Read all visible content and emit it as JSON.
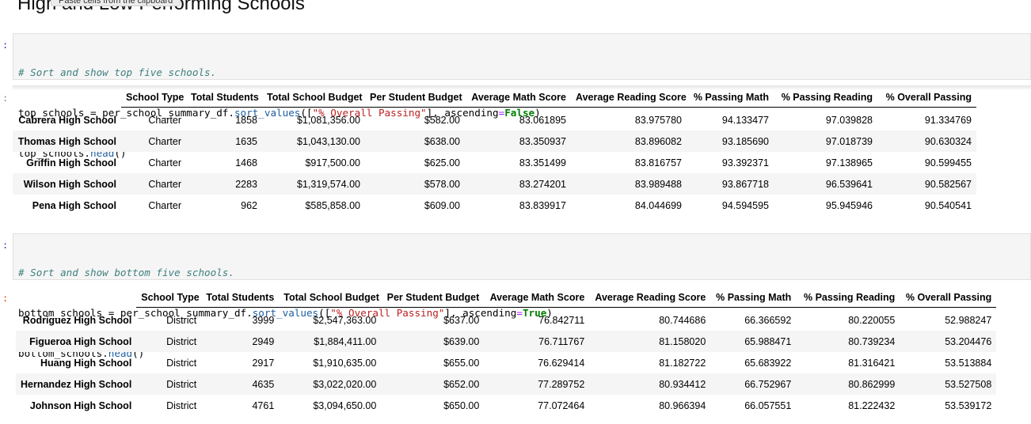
{
  "heading": "High and Low Performing Schools",
  "tooltip": "Paste cells from the clipboard",
  "prompt_colon": ":",
  "top_cell": {
    "comment": "# Sort and show top five schools.",
    "line2_var": "top_schools",
    "line2_eq": " = ",
    "line2_obj": "per_school_summary_df.",
    "line2_fn": "sort_values",
    "line2_open": "([",
    "line2_str": "\"% Overall Passing\"",
    "line2_mid": "], ascending",
    "line2_eqop": "=",
    "line2_kw": "False",
    "line2_close": ")",
    "line3_obj": "top_schools.",
    "line3_fn": "head",
    "line3_close": "()"
  },
  "bottom_cell": {
    "comment": "# Sort and show bottom five schools.",
    "line2_var": "bottom_schools",
    "line2_eq": " = ",
    "line2_obj": "per_school_summary_df.",
    "line2_fn": "sort_values",
    "line2_open": "([",
    "line2_str": "\"% Overall Passing\"",
    "line2_mid": "], ascending",
    "line2_eqop": "=",
    "line2_kw": "True",
    "line2_close": ")",
    "line3_obj": "bottom_schools.",
    "line3_fn": "head",
    "line3_close": "()"
  },
  "columns": [
    "School Type",
    "Total Students",
    "Total School Budget",
    "Per Student Budget",
    "Average Math Score",
    "Average Reading Score",
    "% Passing Math",
    "% Passing Reading",
    "% Overall Passing"
  ],
  "top_rows": [
    {
      "name": "Cabrera High School",
      "cells": [
        "Charter",
        "1858",
        "$1,081,356.00",
        "$582.00",
        "83.061895",
        "83.975780",
        "94.133477",
        "97.039828",
        "91.334769"
      ]
    },
    {
      "name": "Thomas High School",
      "cells": [
        "Charter",
        "1635",
        "$1,043,130.00",
        "$638.00",
        "83.350937",
        "83.896082",
        "93.185690",
        "97.018739",
        "90.630324"
      ]
    },
    {
      "name": "Griffin High School",
      "cells": [
        "Charter",
        "1468",
        "$917,500.00",
        "$625.00",
        "83.351499",
        "83.816757",
        "93.392371",
        "97.138965",
        "90.599455"
      ]
    },
    {
      "name": "Wilson High School",
      "cells": [
        "Charter",
        "2283",
        "$1,319,574.00",
        "$578.00",
        "83.274201",
        "83.989488",
        "93.867718",
        "96.539641",
        "90.582567"
      ]
    },
    {
      "name": "Pena High School",
      "cells": [
        "Charter",
        "962",
        "$585,858.00",
        "$609.00",
        "83.839917",
        "84.044699",
        "94.594595",
        "95.945946",
        "90.540541"
      ]
    }
  ],
  "bottom_rows": [
    {
      "name": "Rodriguez High School",
      "cells": [
        "District",
        "3999",
        "$2,547,363.00",
        "$637.00",
        "76.842711",
        "80.744686",
        "66.366592",
        "80.220055",
        "52.988247"
      ]
    },
    {
      "name": "Figueroa High School",
      "cells": [
        "District",
        "2949",
        "$1,884,411.00",
        "$639.00",
        "76.711767",
        "81.158020",
        "65.988471",
        "80.739234",
        "53.204476"
      ]
    },
    {
      "name": "Huang High School",
      "cells": [
        "District",
        "2917",
        "$1,910,635.00",
        "$655.00",
        "76.629414",
        "81.182722",
        "65.683922",
        "81.316421",
        "53.513884"
      ]
    },
    {
      "name": "Hernandez High School",
      "cells": [
        "District",
        "4635",
        "$3,022,020.00",
        "$652.00",
        "77.289752",
        "80.934412",
        "66.752967",
        "80.862999",
        "53.527508"
      ]
    },
    {
      "name": "Johnson High School",
      "cells": [
        "District",
        "4761",
        "$3,094,650.00",
        "$650.00",
        "77.072464",
        "80.966394",
        "66.057551",
        "81.222432",
        "53.539172"
      ]
    }
  ]
}
